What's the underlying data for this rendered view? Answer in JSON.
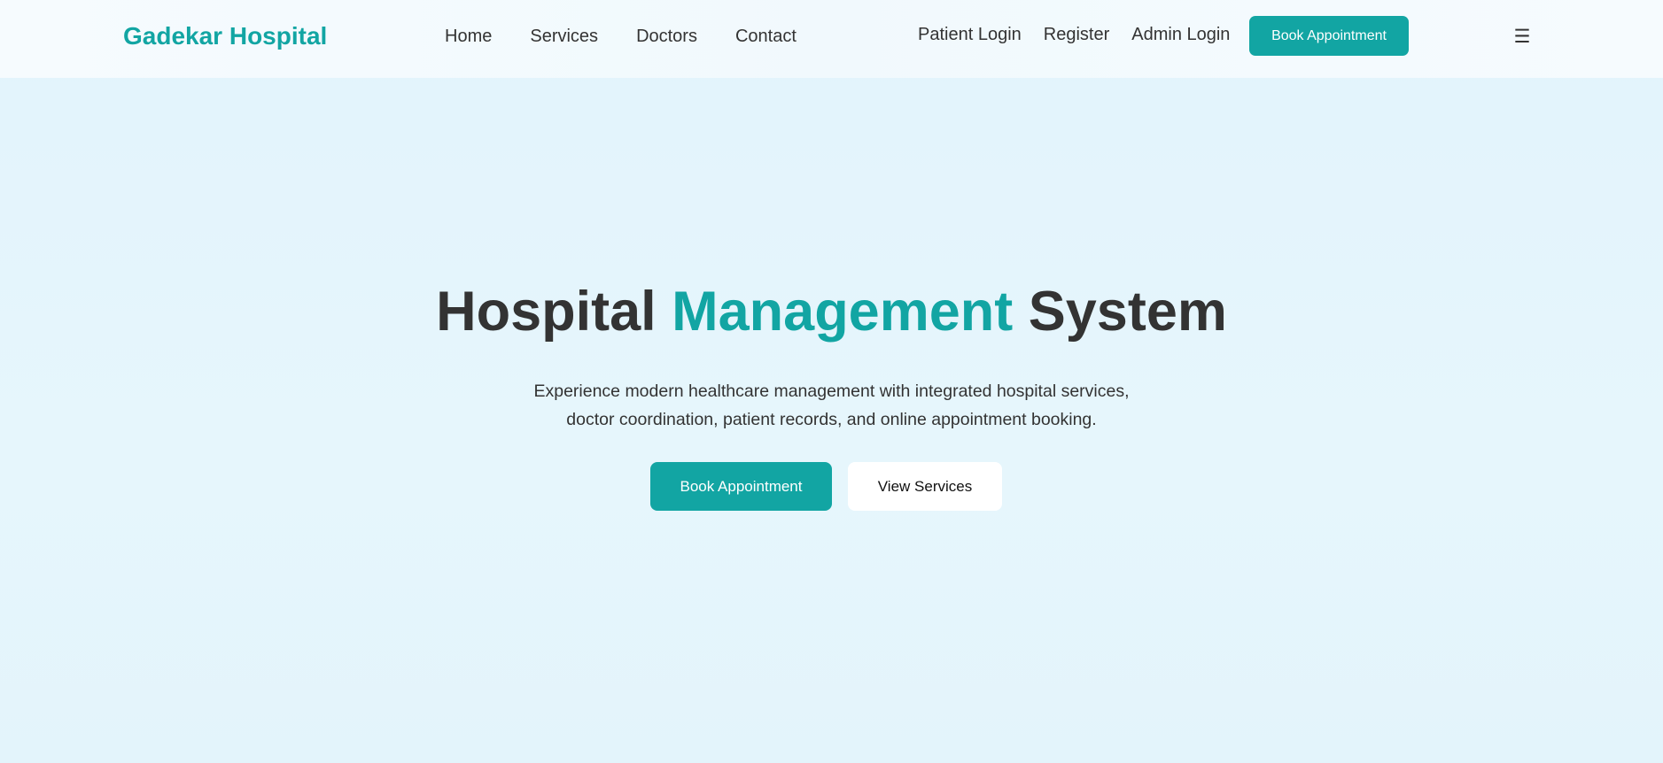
{
  "brand": {
    "name": "Gadekar Hospital",
    "color": "#12a5a3"
  },
  "nav": {
    "items": [
      {
        "label": "Home"
      },
      {
        "label": "Services"
      },
      {
        "label": "Doctors"
      },
      {
        "label": "Contact"
      }
    ]
  },
  "auth": {
    "patient_login": "Patient Login",
    "register": "Register",
    "admin_login": "Admin Login"
  },
  "header": {
    "cta_label": "Book Appointment",
    "menu_icon": "hamburger-icon",
    "menu_glyph": "☰"
  },
  "hero": {
    "title_part1": "Hospital ",
    "title_accent": "Management",
    "title_part2": " System",
    "description_line1": "Experience modern healthcare management with integrated hospital services,",
    "description_line2": "doctor coordination, patient records, and online appointment booking.",
    "primary_button": "Book Appointment",
    "secondary_button": "View Services"
  },
  "colors": {
    "accent": "#12a5a3",
    "text": "#333333",
    "background": "#e4f5fc",
    "button_secondary_bg": "#ffffff"
  }
}
